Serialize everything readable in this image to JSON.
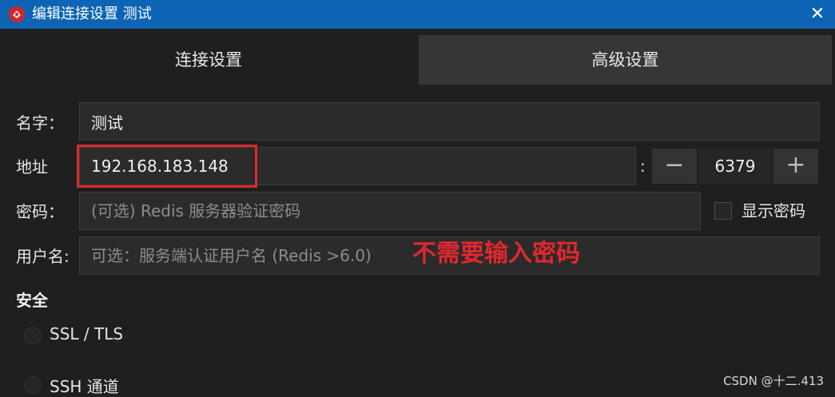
{
  "window": {
    "title": "编辑连接设置 测试",
    "close_glyph": "✕",
    "icon": "redis-app-icon"
  },
  "tabs": [
    {
      "label": "连接设置",
      "active": true
    },
    {
      "label": "高级设置",
      "active": false
    }
  ],
  "form": {
    "name_label": "名字：",
    "name_value": "测试",
    "address_label": "地址",
    "address_value": "192.168.183.148",
    "port_separator": ":",
    "port_decrement": "−",
    "port_value": "6379",
    "port_increment": "+",
    "password_label": "密码：",
    "password_placeholder": "(可选) Redis 服务器验证密码",
    "show_password_label": "显示密码",
    "username_label": "用户名:",
    "username_placeholder": "可选：服务端认证用户名 (Redis >6.0)"
  },
  "annotation": "不需要输入密码",
  "security": {
    "title": "安全",
    "options": [
      {
        "label": "SSL / TLS"
      },
      {
        "label": "SSH 通道"
      }
    ]
  },
  "watermark": "CSDN @十二.413",
  "colors": {
    "titlebar": "#0e64b4",
    "annotation": "#e0282e",
    "background": "#1f1f1f"
  }
}
